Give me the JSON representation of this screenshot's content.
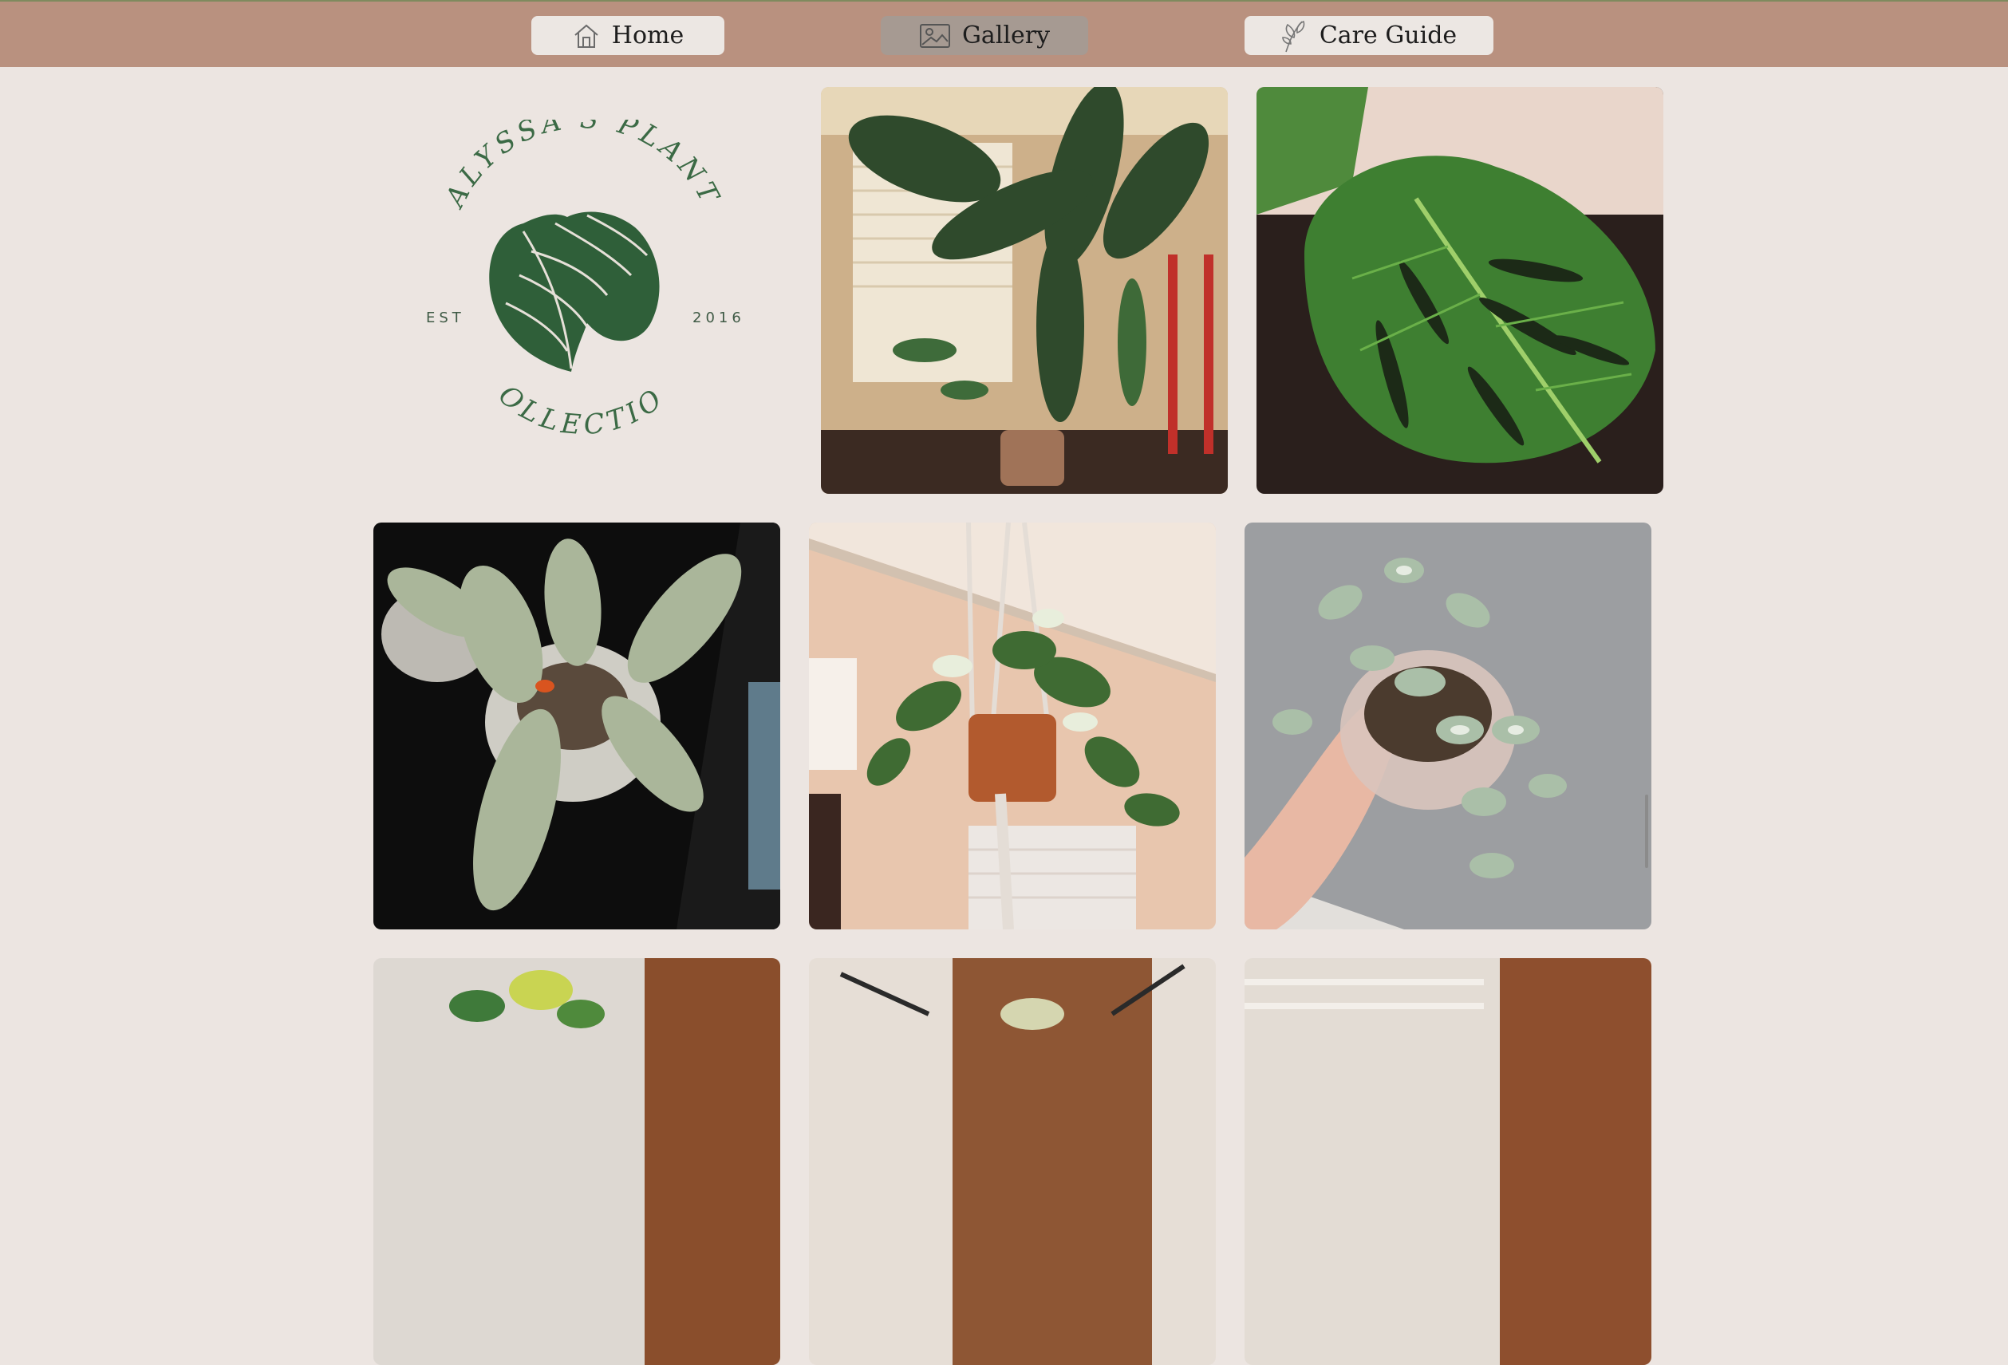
{
  "nav": {
    "home": {
      "label": "Home",
      "icon": "house-icon"
    },
    "gallery": {
      "label": "Gallery",
      "icon": "picture-icon",
      "active": true
    },
    "care": {
      "label": "Care Guide",
      "icon": "leaf-sketch-icon"
    }
  },
  "logo": {
    "top_text": "ALYSSA'S PLANT",
    "bottom_text": "COLLECTION",
    "left_text": "EST",
    "right_text": "2016",
    "color": "#336140"
  },
  "gallery": {
    "photos": [
      {
        "name": "bird-of-paradise-room-photo"
      },
      {
        "name": "monstera-leaf-photo"
      },
      {
        "name": "silver-philodendron-photo"
      },
      {
        "name": "hanging-pothos-photo"
      },
      {
        "name": "hoya-in-hand-photo"
      },
      {
        "name": "dieffenbachia-photo"
      },
      {
        "name": "variegated-plant-stand-photo"
      },
      {
        "name": "plant-by-window-photo"
      }
    ]
  },
  "colors": {
    "navbar": "#b9917f",
    "background": "#ece5e1",
    "button": "#ece7e3",
    "button_active": "#a69a92"
  }
}
